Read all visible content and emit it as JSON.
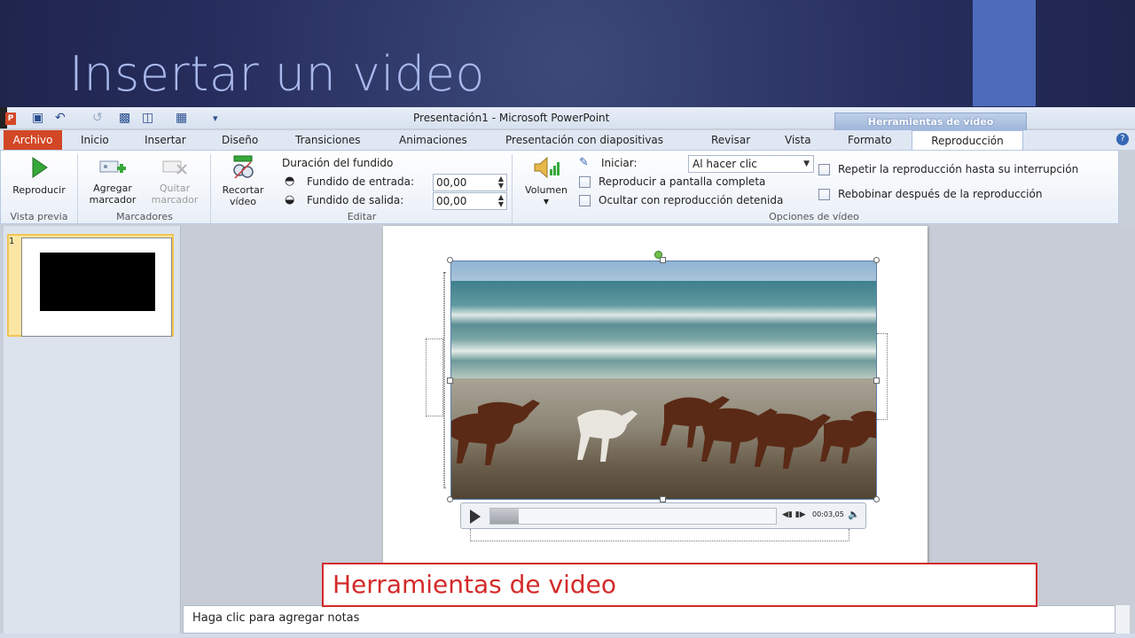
{
  "slide": {
    "title": "Insertar un video",
    "callout": "Herramientas de video",
    "accent_color": "#4e6bbb",
    "callout_color": "#d42a2a"
  },
  "app": {
    "window_title": "Presentación1  -  Microsoft PowerPoint",
    "office_icon": "P",
    "context_tab_header": "Herramientas de vídeo",
    "quick_access_icons": [
      "save-icon",
      "undo-icon",
      "redo-icon",
      "customize-icon"
    ]
  },
  "tabs": [
    {
      "label": "Archivo"
    },
    {
      "label": "Inicio"
    },
    {
      "label": "Insertar"
    },
    {
      "label": "Diseño"
    },
    {
      "label": "Transiciones"
    },
    {
      "label": "Animaciones"
    },
    {
      "label": "Presentación con diapositivas"
    },
    {
      "label": "Revisar"
    },
    {
      "label": "Vista"
    },
    {
      "label": "Formato"
    },
    {
      "label": "Reproducción"
    }
  ],
  "ribbon": {
    "preview": {
      "play_label": "Reproducir",
      "group": "Vista previa"
    },
    "bookmarks": {
      "add_label_1": "Agregar",
      "add_label_2": "marcador",
      "remove_label_1": "Quitar",
      "remove_label_2": "marcador",
      "group": "Marcadores"
    },
    "edit": {
      "trim_label_1": "Recortar",
      "trim_label_2": "vídeo",
      "fade_title": "Duración del fundido",
      "fade_in_label": "Fundido de entrada:",
      "fade_in_value": "00,00",
      "fade_out_label": "Fundido de salida:",
      "fade_out_value": "00,00",
      "group": "Editar"
    },
    "video_options": {
      "volume_label": "Volumen",
      "start_label": "Iniciar:",
      "start_value": "Al hacer clic",
      "fullscreen_label": "Reproducir a pantalla completa",
      "hide_label": "Ocultar con reproducción detenida",
      "loop_label": "Repetir la reproducción hasta su interrupción",
      "rewind_label": "Rebobinar después de la reproducción",
      "group": "Opciones de vídeo"
    }
  },
  "thumbnails": [
    {
      "number": "1"
    }
  ],
  "player": {
    "time": "00:03,05",
    "progress_fraction": 0.1
  },
  "notes": {
    "placeholder": "Haga clic para agregar notas"
  }
}
